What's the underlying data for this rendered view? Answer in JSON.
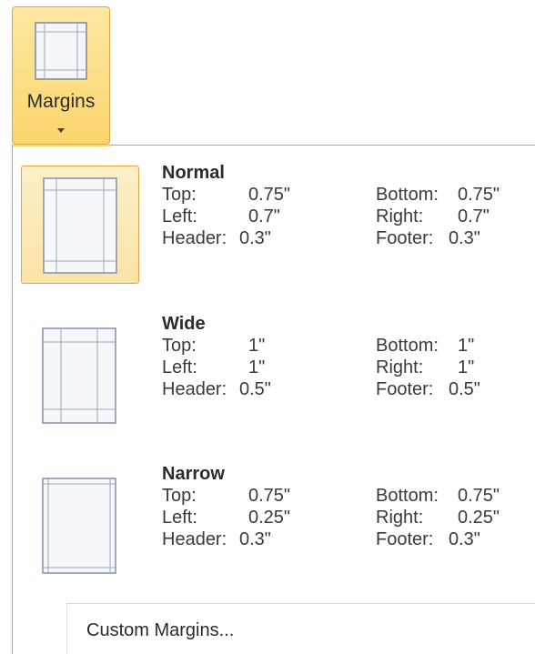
{
  "ribbon": {
    "margins_label": "Margins",
    "icon": "page-margins-icon"
  },
  "options": [
    {
      "name": "Normal",
      "selected": true,
      "icon": "page-normal-margins-icon",
      "top_label": "Top:",
      "top_value": "0.75\"",
      "bottom_label": "Bottom:",
      "bottom_value": "0.75\"",
      "left_label": "Left:",
      "left_value": "0.7\"",
      "right_label": "Right:",
      "right_value": "0.7\"",
      "header_label": "Header:",
      "header_value": "0.3\"",
      "footer_label": "Footer:",
      "footer_value": "0.3\""
    },
    {
      "name": "Wide",
      "selected": false,
      "icon": "page-wide-margins-icon",
      "top_label": "Top:",
      "top_value": "1\"",
      "bottom_label": "Bottom:",
      "bottom_value": "1\"",
      "left_label": "Left:",
      "left_value": "1\"",
      "right_label": "Right:",
      "right_value": "1\"",
      "header_label": "Header:",
      "header_value": "0.5\"",
      "footer_label": "Footer:",
      "footer_value": "0.5\""
    },
    {
      "name": "Narrow",
      "selected": false,
      "icon": "page-narrow-margins-icon",
      "top_label": "Top:",
      "top_value": "0.75\"",
      "bottom_label": "Bottom:",
      "bottom_value": "0.75\"",
      "left_label": "Left:",
      "left_value": "0.25\"",
      "right_label": "Right:",
      "right_value": "0.25\"",
      "header_label": "Header:",
      "header_value": "0.3\"",
      "footer_label": "Footer:",
      "footer_value": "0.3\""
    }
  ],
  "custom": {
    "label": "Custom Margins..."
  },
  "colors": {
    "button_highlight": "#fbd66d",
    "button_border": "#d9a93d",
    "selected_fill": "#fbe3a6",
    "guide_line": "#9aa7bd"
  }
}
